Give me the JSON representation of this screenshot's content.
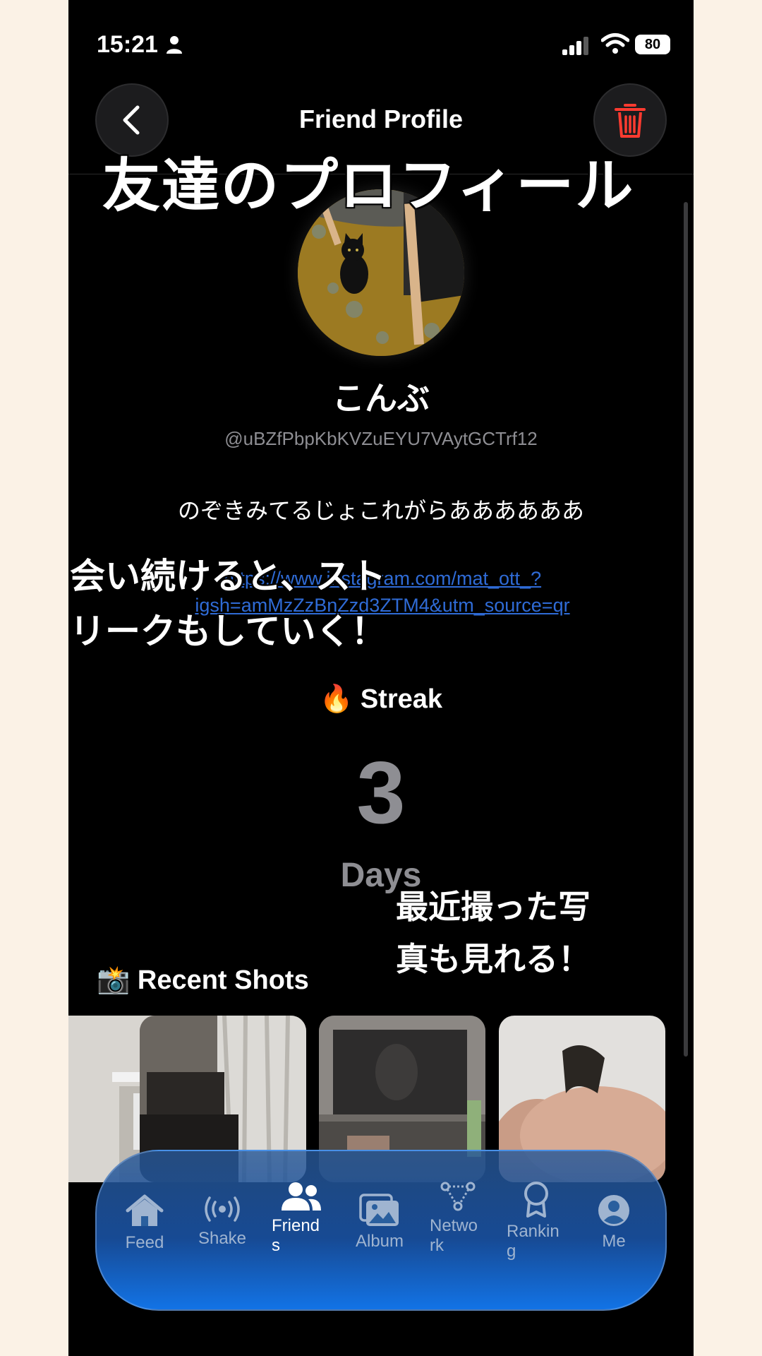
{
  "status_bar": {
    "time": "15:21",
    "battery": "80"
  },
  "header": {
    "title": "Friend Profile"
  },
  "overlays": {
    "title_jp": "友達のプロフィール",
    "streak_jp_line1": "会い続けると、スト",
    "streak_jp_line2": "リークもしていく！",
    "shots_jp_line1": "最近撮った写",
    "shots_jp_line2": "真も見れる！"
  },
  "profile": {
    "name": "こんぶ",
    "handle": "@uBZfPbpKbKVZuEYU7VAytGCTrf12",
    "bio": "のぞきみてるじょこれがらああああああ",
    "link_line1": "https://www.instagram.com/mat_ott_?",
    "link_line2": "igsh=amMzZzBnZzd3ZTM4&utm_source=qr"
  },
  "streak": {
    "label": "🔥 Streak",
    "count": "3",
    "unit": "Days"
  },
  "recent": {
    "title": "📸 Recent Shots"
  },
  "tabs": [
    {
      "label": "Feed",
      "icon": "home-icon"
    },
    {
      "label": "Shake",
      "icon": "broadcast-icon"
    },
    {
      "label": "Friend\ns",
      "icon": "people-icon",
      "active": true
    },
    {
      "label": "Album",
      "icon": "photos-icon"
    },
    {
      "label": "Netwo\nrk",
      "icon": "network-icon"
    },
    {
      "label": "Rankin\ng",
      "icon": "ribbon-icon"
    },
    {
      "label": "Me",
      "icon": "person-circle-icon"
    }
  ],
  "colors": {
    "accent": "#1273e6",
    "danger": "#ff3b30",
    "link": "#2f6bd6",
    "muted": "#8e8e93"
  }
}
